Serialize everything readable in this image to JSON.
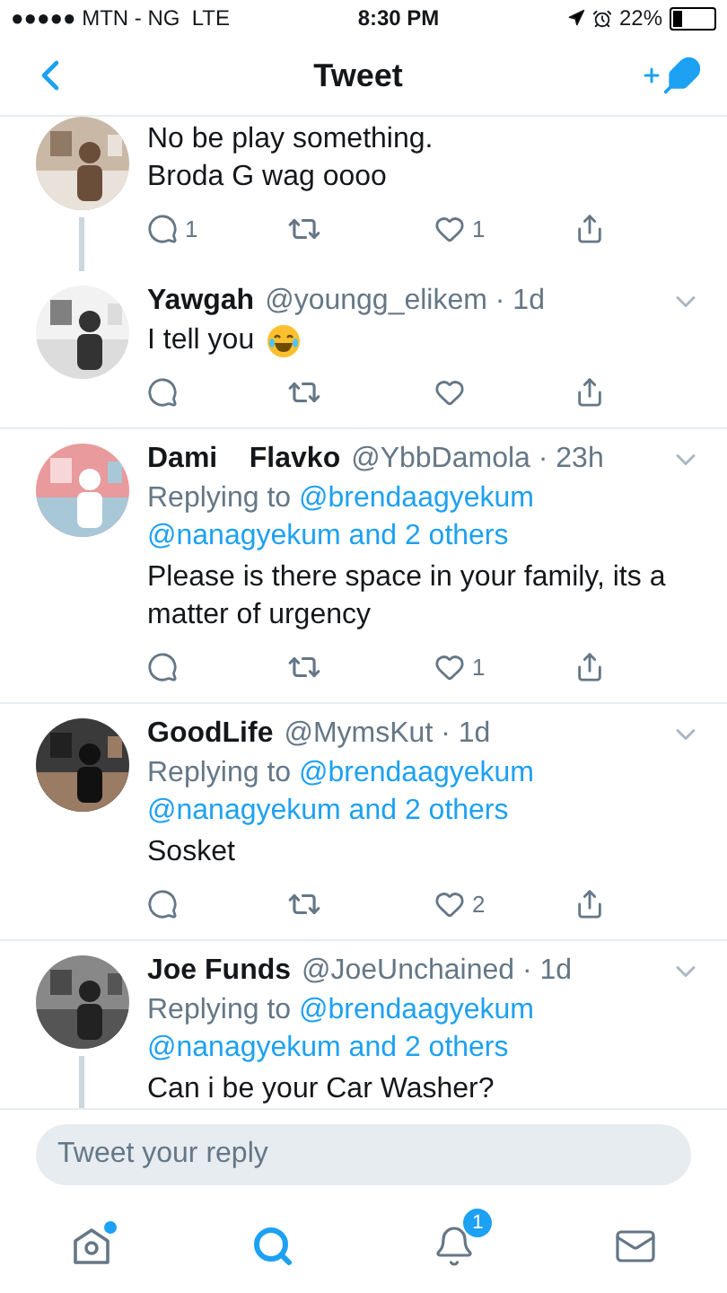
{
  "status_bar": {
    "carrier": "●●●●● MTN - NG  LTE",
    "time": "8:30 PM",
    "battery": "22%"
  },
  "header": {
    "title": "Tweet"
  },
  "tweets": [
    {
      "body": "No be play something.\nBroda G wag oooo",
      "thread_below": true,
      "show_actions": true,
      "replies": "1",
      "likes": "1"
    },
    {
      "name": "Yawgah",
      "meta": "@youngg_elikem · 1d",
      "body": "I tell you",
      "has_emoji": true,
      "show_actions": true
    },
    {
      "name": "Dami    Flavko",
      "meta": "@YbbDamola · 23h",
      "replying_to": {
        "prefix": "Replying to",
        "mentions": [
          "@brendaagyekum",
          "@nanagyekum and 2 others"
        ]
      },
      "body": "Please is there space in your family, its a matter of urgency",
      "show_actions": true,
      "likes": "1"
    },
    {
      "name": "GoodLife",
      "meta": "@MymsKut · 1d",
      "replying_to": {
        "prefix": "Replying to",
        "mentions": [
          "@brendaagyekum",
          "@nanagyekum and 2 others"
        ]
      },
      "body": "Sosket",
      "show_actions": true,
      "likes": "2"
    },
    {
      "name": "Joe Funds",
      "meta": "@JoeUnchained · 1d",
      "replying_to": {
        "prefix": "Replying to",
        "mentions": [
          "@brendaagyekum",
          "@nanagyekum and 2 others"
        ]
      },
      "body": "Can i be your Car Washer?",
      "thread_below": true
    }
  ],
  "composer": {
    "placeholder": "Tweet your reply"
  },
  "tab_bar": [
    {
      "kind": "home",
      "selected": false,
      "has_new": true
    },
    {
      "kind": "search",
      "selected": true
    },
    {
      "kind": "notifications",
      "selected": false,
      "badge": "1"
    },
    {
      "kind": "messages",
      "selected": false
    }
  ]
}
